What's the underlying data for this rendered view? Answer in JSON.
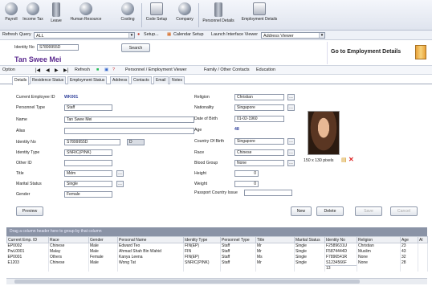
{
  "toolbar": {
    "items": [
      {
        "label": "Payroll",
        "icon": "payroll-icon"
      },
      {
        "label": "Income Tax",
        "icon": "income-tax-icon"
      },
      {
        "label": "Leave",
        "icon": "leave-icon"
      },
      {
        "label": "Human Resource",
        "icon": "human-resource-icon"
      },
      {
        "label": "Costing",
        "icon": "costing-icon"
      },
      {
        "label": "Code Setup",
        "icon": "code-setup-icon"
      },
      {
        "label": "Company",
        "icon": "company-icon"
      },
      {
        "label": "Personnel Details",
        "icon": "personnel-details-icon"
      },
      {
        "label": "Employment Details",
        "icon": "employment-details-icon"
      }
    ]
  },
  "query_bar": {
    "refresh": "Refresh",
    "query_label": "Query",
    "query_value": "ALL",
    "setup": "Setup...",
    "calendar_setup": "Calendar Setup",
    "launch_viewer": "Launch Interface Viewer",
    "viewer_value": "Address Viewer"
  },
  "header": {
    "identity_label": "Identity No",
    "identity_value": "S7899955D",
    "search_button": "Search",
    "employee_name": "Tan Swee Mei",
    "goto_label": "Go to  Employment Details"
  },
  "nav": {
    "options": "Option",
    "refresh": "Refresh",
    "viewer": "Personnel / Employment Viewer",
    "family": "Family / Other Contacts",
    "education": "Education"
  },
  "tabs": [
    "Details",
    "Residence Status",
    "Employment Status",
    "Address",
    "Contacts",
    "Email",
    "Notes"
  ],
  "form_left": {
    "current_employee_id": {
      "label": "Current Employee ID",
      "value": "WK001"
    },
    "personnel_type": {
      "label": "Personnel Type",
      "value": "Staff"
    },
    "name": {
      "label": "Name",
      "value": "Tan Swee Mei"
    },
    "alias": {
      "label": "Alias",
      "value": ""
    },
    "identity_no": {
      "label": "Identity No",
      "value": "S7899955D",
      "check": "D"
    },
    "identity_type": {
      "label": "Identity Type",
      "value": "SNRIC(PINK)"
    },
    "other_id": {
      "label": "Other ID",
      "value": ""
    },
    "title": {
      "label": "Title",
      "value": "Mdm"
    },
    "marital_status": {
      "label": "Marital Status",
      "value": "Single"
    },
    "gender": {
      "label": "Gender",
      "value": "Female"
    }
  },
  "form_right": {
    "religion": {
      "label": "Religion",
      "value": "Christian"
    },
    "nationality": {
      "label": "Nationality",
      "value": "Singapore"
    },
    "date_of_birth": {
      "label": "Date of Birth",
      "value": "01-02-1960"
    },
    "age": {
      "label": "Age",
      "value": "48"
    },
    "country_of_birth": {
      "label": "Country Of Birth",
      "value": "Singapore"
    },
    "race": {
      "label": "Race",
      "value": "Chinese"
    },
    "blood_group": {
      "label": "Blood Group",
      "value": "None"
    },
    "height": {
      "label": "Height",
      "value": "0"
    },
    "weight": {
      "label": "Weight",
      "value": "0"
    },
    "passport_country": {
      "label": "Passport Country Issue",
      "value": ""
    }
  },
  "photo": {
    "caption": "150 x 130 pixels"
  },
  "buttons": {
    "preview": "Preview",
    "new": "New",
    "delete": "Delete",
    "save": "Save",
    "cancel": "Cancel"
  },
  "grid": {
    "caption": "Drag a column header here to group by that column",
    "columns": [
      "Current Emp. ID",
      "Race",
      "Gender",
      "Personal Name",
      "Identity Type",
      "Personnel Type",
      "Title",
      "Marital Status",
      "Identity No",
      "Religion",
      "Age",
      "Al"
    ],
    "rows": [
      [
        "EP0002",
        "Chinese",
        "Male",
        "Edward Teo",
        "FIN(EP)",
        "Staff",
        "Mr",
        "Single",
        "F2589631U",
        "Christian",
        "23",
        ""
      ],
      [
        "PwL0001",
        "Malay",
        "Male",
        "Ahmad Shah Bin Wahid",
        "FIN",
        "Staff",
        "Mr",
        "Single",
        "F5874444D",
        "Muslim",
        "43",
        ""
      ],
      [
        "EP0001",
        "Others",
        "Female",
        "Kanya Leena",
        "FIN(EP)",
        "Staff",
        "Ms",
        "Single",
        "F7896541R",
        "None",
        "32",
        ""
      ],
      [
        "E1203",
        "Chinese",
        "Male",
        "Wong Tat",
        "SNRIC(PINK)",
        "Staff",
        "Mr",
        "Single",
        "S1234566F",
        "None",
        "28",
        ""
      ]
    ],
    "footer": "13"
  }
}
